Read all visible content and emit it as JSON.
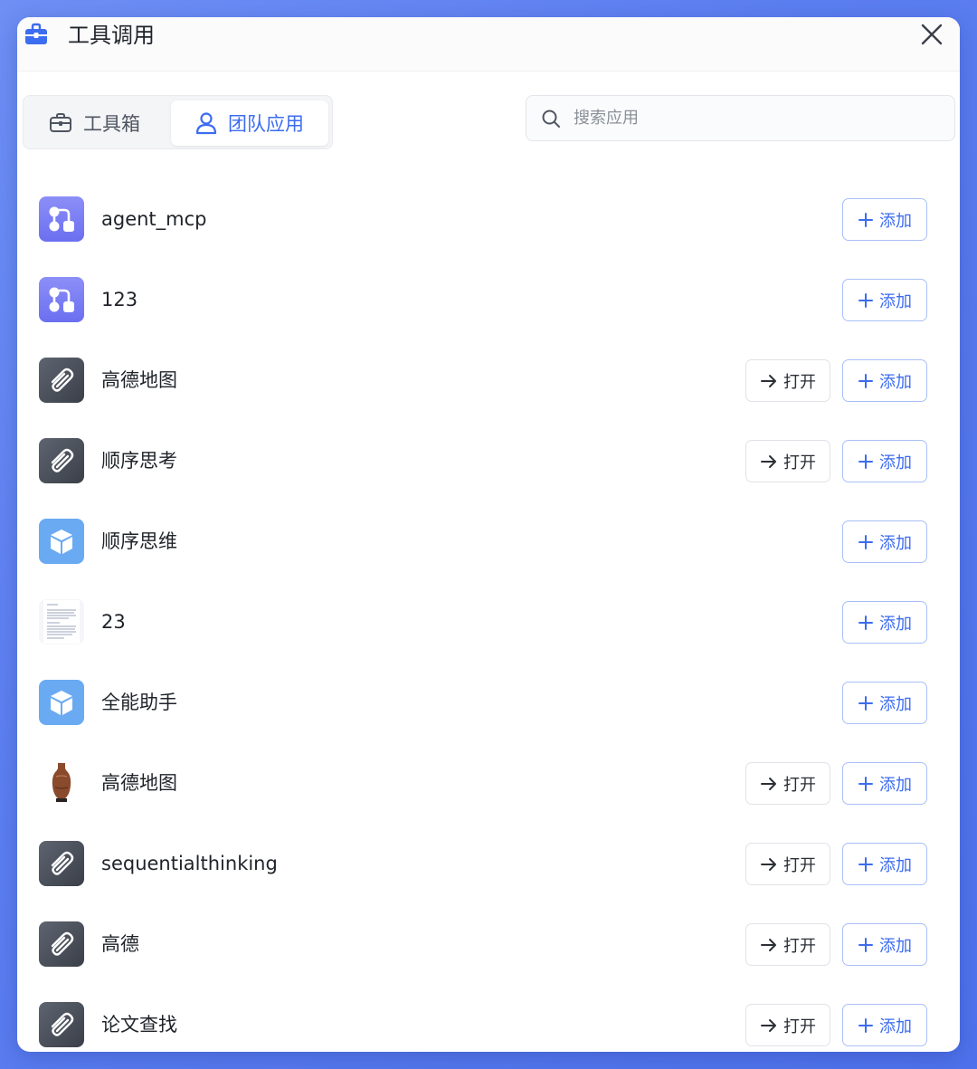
{
  "dialog": {
    "title": "工具调用",
    "close_icon": "close-icon",
    "accent_color": "#3c6cf0"
  },
  "tabs": [
    {
      "label": "工具箱",
      "icon": "toolbox-icon",
      "active": false
    },
    {
      "label": "团队应用",
      "icon": "user-icon",
      "active": true
    }
  ],
  "search": {
    "placeholder": "搜索应用",
    "value": ""
  },
  "buttons": {
    "open_label": "打开",
    "add_label": "添加"
  },
  "apps": [
    {
      "name": "agent_mcp",
      "icon": "workflow-icon",
      "has_open": false
    },
    {
      "name": "123",
      "icon": "workflow-icon",
      "has_open": false
    },
    {
      "name": "高德地图",
      "icon": "paperclip-icon",
      "has_open": true
    },
    {
      "name": "顺序思考",
      "icon": "paperclip-icon",
      "has_open": true
    },
    {
      "name": "顺序思维",
      "icon": "cube-icon",
      "has_open": false
    },
    {
      "name": "23",
      "icon": "document-thumbnail",
      "has_open": false
    },
    {
      "name": "全能助手",
      "icon": "cube-icon",
      "has_open": false
    },
    {
      "name": "高德地图",
      "icon": "vase-thumbnail",
      "has_open": true
    },
    {
      "name": "sequentialthinking",
      "icon": "paperclip-icon",
      "has_open": true
    },
    {
      "name": "高德",
      "icon": "paperclip-icon",
      "has_open": true
    },
    {
      "name": "论文查找",
      "icon": "paperclip-icon",
      "has_open": true
    }
  ]
}
